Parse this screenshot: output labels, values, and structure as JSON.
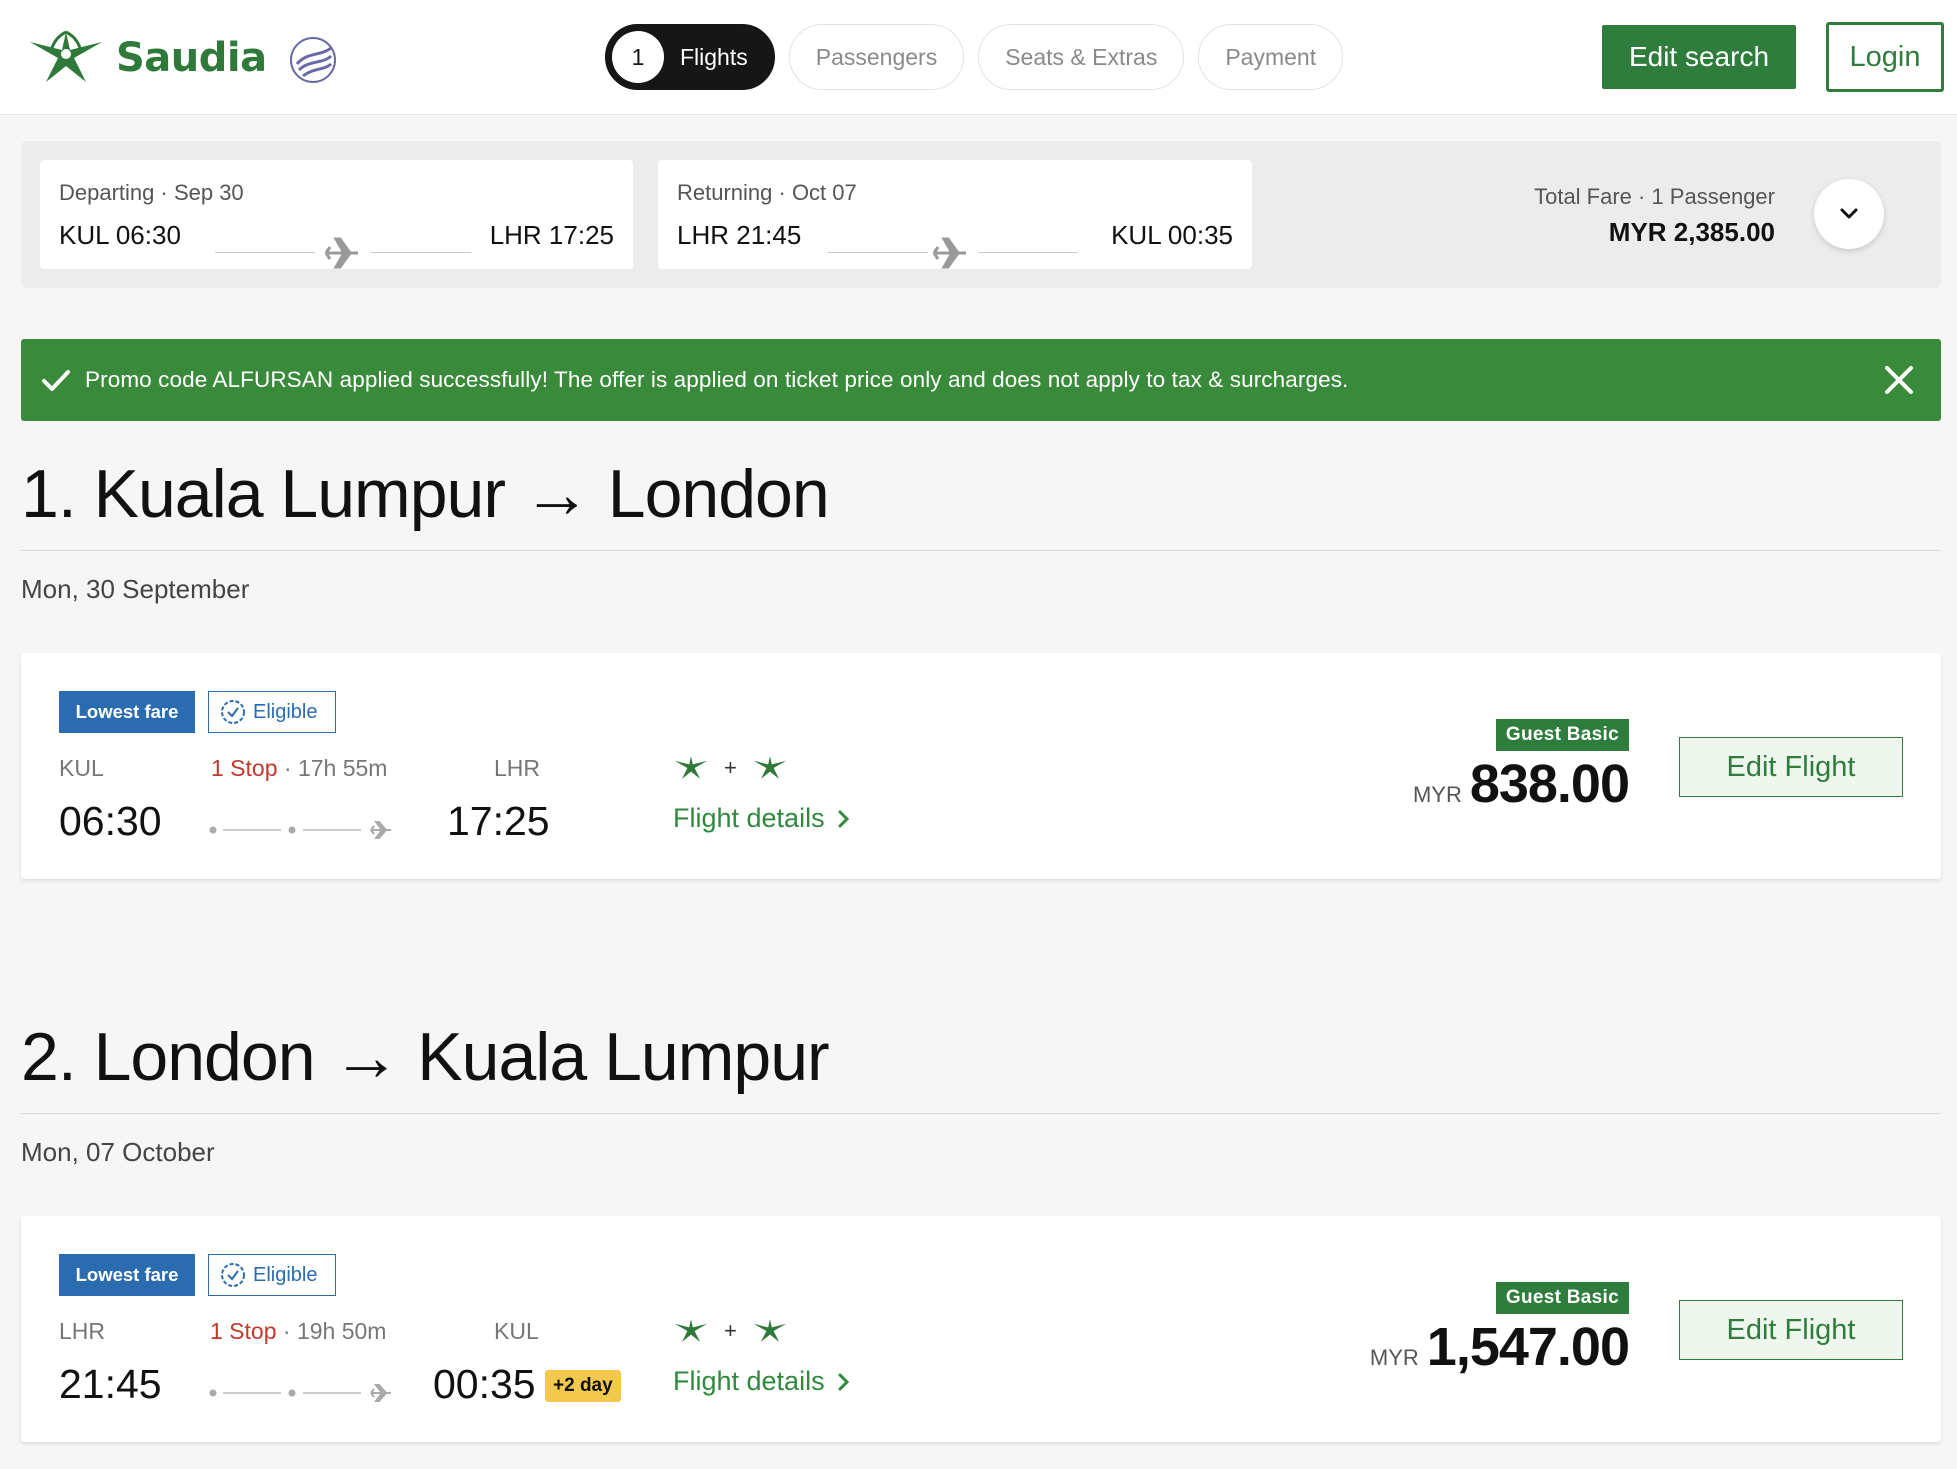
{
  "header": {
    "brand": "Saudia",
    "steps": [
      {
        "num": "1",
        "label": "Flights"
      },
      {
        "label": "Passengers"
      },
      {
        "label": "Seats & Extras"
      },
      {
        "label": "Payment"
      }
    ],
    "edit_search": "Edit search",
    "login": "Login"
  },
  "summary": {
    "departing": {
      "label": "Departing · Sep 30",
      "from": "KUL 06:30",
      "to": "LHR 17:25"
    },
    "returning": {
      "label": "Returning · Oct 07",
      "from": "LHR 21:45",
      "to": "KUL 00:35"
    },
    "fare_label": "Total Fare · 1 Passenger",
    "fare_value": "MYR 2,385.00"
  },
  "promo": {
    "message": "Promo code ALFURSAN applied successfully! The offer is applied on ticket price only and does not apply to tax & surcharges."
  },
  "sections": [
    {
      "title": "1. Kuala Lumpur → London",
      "date": "Mon, 30 September",
      "flight": {
        "badge_lowest": "Lowest fare",
        "badge_eligible": "Eligible",
        "from_code": "KUL",
        "to_code": "LHR",
        "stops": "1 Stop",
        "duration": " · 17h 55m",
        "dep_time": "06:30",
        "arr_time": "17:25",
        "plus_day": "",
        "carrier_plus": "+",
        "details": "Flight details",
        "fare_class": "Guest Basic",
        "currency": "MYR",
        "price": "838.00",
        "edit": "Edit Flight"
      }
    },
    {
      "title": "2. London → Kuala Lumpur",
      "date": "Mon, 07 October",
      "flight": {
        "badge_lowest": "Lowest fare",
        "badge_eligible": "Eligible",
        "from_code": "LHR",
        "to_code": "KUL",
        "stops": "1 Stop",
        "duration": " · 19h 50m",
        "dep_time": "21:45",
        "arr_time": "00:35",
        "plus_day": "+2 day",
        "carrier_plus": "+",
        "details": "Flight details",
        "fare_class": "Guest Basic",
        "currency": "MYR",
        "price": "1,547.00",
        "edit": "Edit Flight"
      }
    }
  ],
  "icons": {
    "brand_logo": "saudia-palm-logo-icon",
    "alliance": "skyteam-icon",
    "plane": "plane-icon",
    "chevron": "chevron-down-icon",
    "check": "check-icon",
    "close": "close-icon"
  },
  "colors": {
    "brand_green": "#2f7d3d",
    "promo_green": "#3a8a3b",
    "badge_blue": "#2b6cb0",
    "stop_red": "#c0392b",
    "plus_day_yellow": "#f2c94c"
  }
}
